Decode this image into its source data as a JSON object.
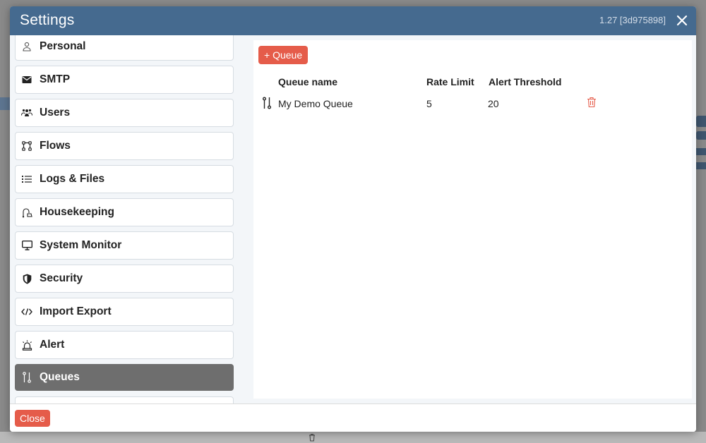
{
  "modal": {
    "title": "Settings",
    "version": "1.27 [3d975898]"
  },
  "sidebar": {
    "items": [
      {
        "label": "Personal",
        "icon": "person-icon"
      },
      {
        "label": "SMTP",
        "icon": "envelope-icon"
      },
      {
        "label": "Users",
        "icon": "users-icon"
      },
      {
        "label": "Flows",
        "icon": "flows-icon"
      },
      {
        "label": "Logs & Files",
        "icon": "list-icon"
      },
      {
        "label": "Housekeeping",
        "icon": "vacuum-icon"
      },
      {
        "label": "System Monitor",
        "icon": "monitor-icon"
      },
      {
        "label": "Security",
        "icon": "shield-icon"
      },
      {
        "label": "Import Export",
        "icon": "code-icon"
      },
      {
        "label": "Alert",
        "icon": "siren-icon"
      },
      {
        "label": "Queues",
        "icon": "queue-icon",
        "active": true
      }
    ]
  },
  "main": {
    "add_button_label": "+ Queue",
    "table": {
      "headers": [
        "Queue name",
        "Rate Limit",
        "Alert Threshold"
      ],
      "rows": [
        {
          "name": "My Demo Queue",
          "rate_limit": "5",
          "alert_threshold": "20"
        }
      ]
    }
  },
  "footer": {
    "close_label": "Close"
  },
  "colors": {
    "header": "#456a8f",
    "accent": "#e55c4a",
    "active_item": "#6e6e6e"
  }
}
